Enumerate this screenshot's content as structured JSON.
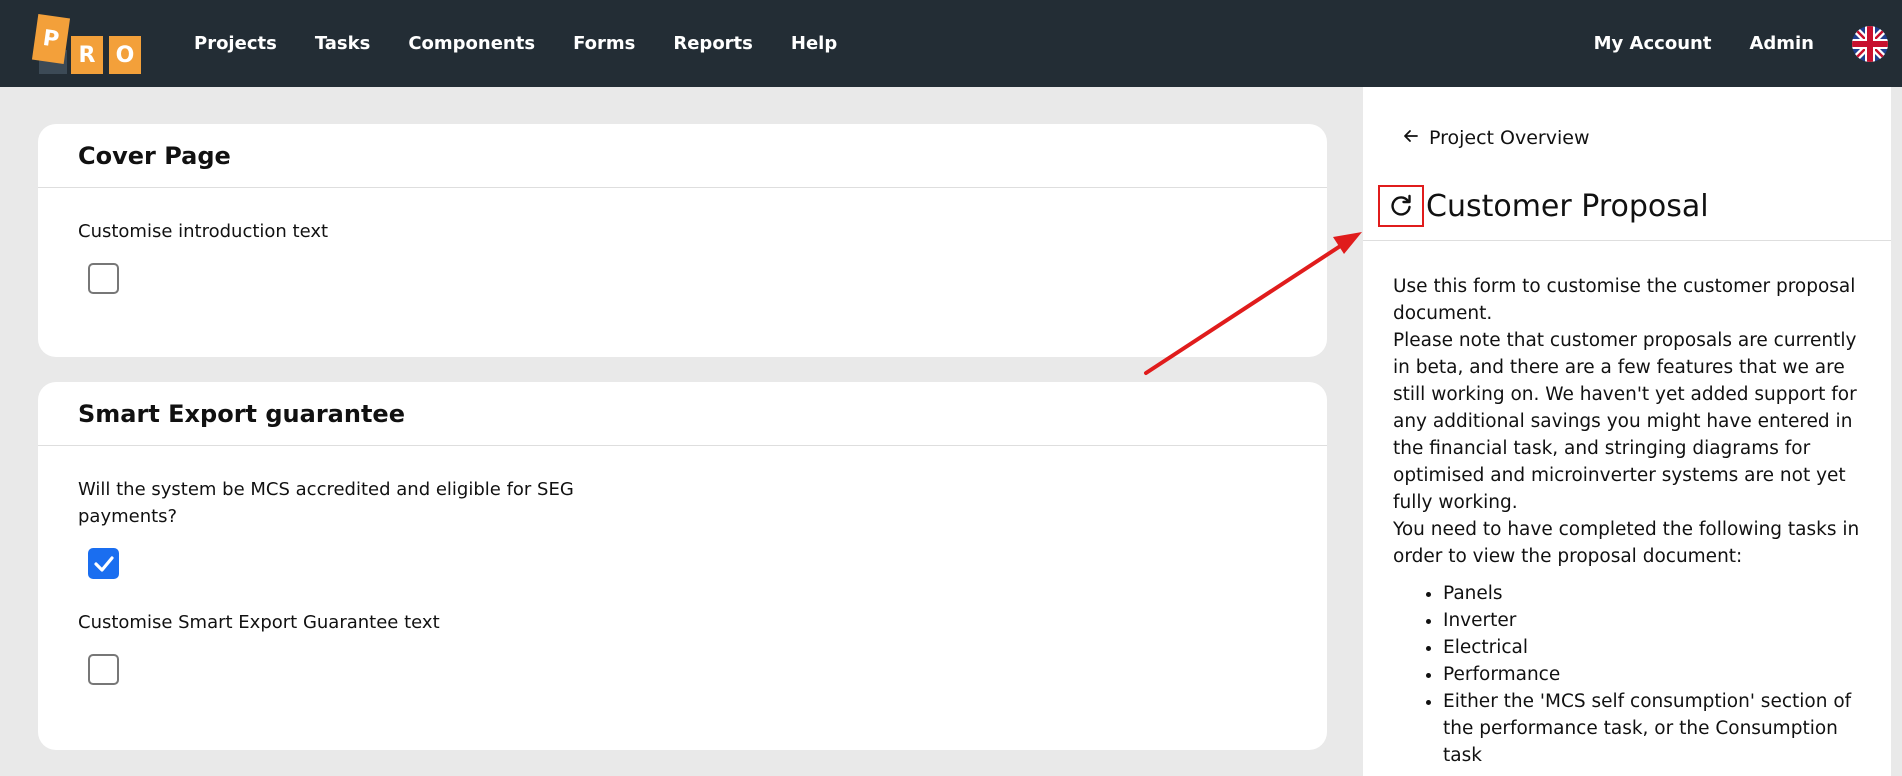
{
  "header": {
    "logo_letters": [
      "P",
      "R",
      "O"
    ],
    "nav": [
      "Projects",
      "Tasks",
      "Components",
      "Forms",
      "Reports",
      "Help"
    ],
    "right_nav": [
      "My Account",
      "Admin"
    ],
    "flag_icon": "uk-flag-icon"
  },
  "cards": [
    {
      "title": "Cover Page",
      "fields": [
        {
          "label": "Customise introduction text",
          "checked": false
        }
      ]
    },
    {
      "title": "Smart Export guarantee",
      "fields": [
        {
          "label": "Will the system be MCS accredited and eligible for SEG payments?",
          "checked": true
        },
        {
          "label": "Customise Smart Export Guarantee text",
          "checked": false
        }
      ]
    }
  ],
  "panel": {
    "back_label": "Project Overview",
    "title": "Customer Proposal",
    "intro": "Use this form to customise the customer proposal document.",
    "note": "Please note that customer proposals are currently in beta, and there are a few features that we are still working on. We haven't yet added support for any additional savings you might have entered in the financial task, and stringing diagrams for optimised and microinverter systems are not yet fully working.",
    "requirements_intro": "You need to have completed the following tasks in order to view the proposal document:",
    "requirements": [
      "Panels",
      "Inverter",
      "Electrical",
      "Performance",
      "Either the 'MCS self consumption' section of the performance task, or the Consumption task"
    ]
  },
  "colors": {
    "topbar": "#232d35",
    "logo": "#f3a03a",
    "checkbox_checked": "#1a6ef0",
    "annotation": "#e01c1c"
  }
}
